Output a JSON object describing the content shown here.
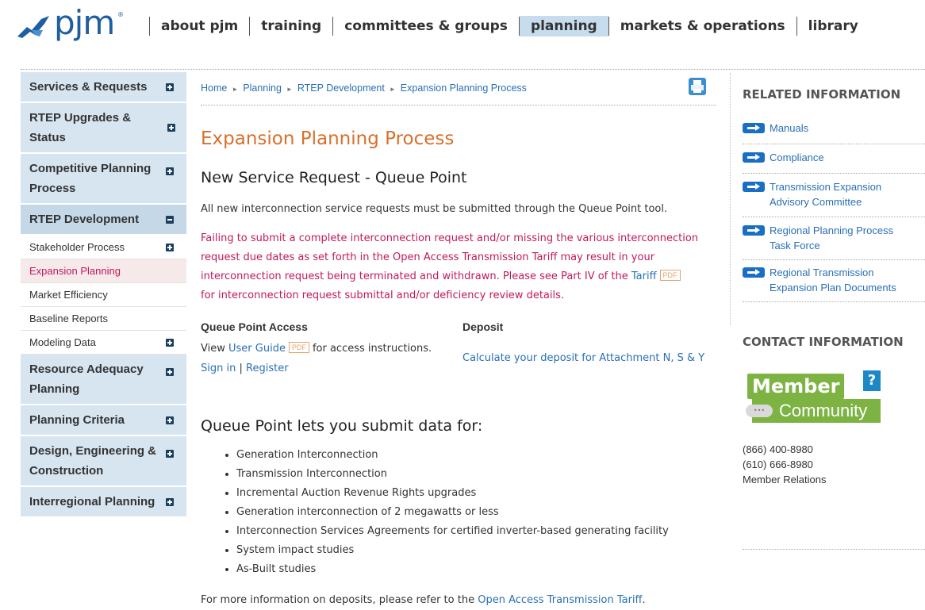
{
  "header": {
    "logo_text": "pjm",
    "logo_mark": "®",
    "nav": [
      {
        "label": "about pjm"
      },
      {
        "label": "training"
      },
      {
        "label": "committees & groups"
      },
      {
        "label": "planning",
        "active": true
      },
      {
        "label": "markets & operations"
      },
      {
        "label": "library"
      }
    ]
  },
  "sidebar": {
    "items": [
      {
        "label": "Services & Requests"
      },
      {
        "label": "RTEP Upgrades & Status"
      },
      {
        "label": "Competitive Planning Process"
      },
      {
        "label": "RTEP Development"
      },
      {
        "label": "Resource Adequacy Planning"
      },
      {
        "label": "Planning Criteria"
      },
      {
        "label": "Design, Engineering & Construction"
      },
      {
        "label": "Interregional Planning"
      }
    ],
    "subitems": [
      {
        "label": "Stakeholder Process"
      },
      {
        "label": "Expansion Planning Process"
      },
      {
        "label": "Market Efficiency"
      },
      {
        "label": "Baseline Reports"
      },
      {
        "label": "Modeling Data"
      }
    ]
  },
  "breadcrumb": [
    "Home",
    "Planning",
    "RTEP Development",
    "Expansion Planning Process"
  ],
  "main": {
    "title": "Expansion Planning Process",
    "subtitle": "New Service Request - Queue Point",
    "intro": "All new interconnection service requests must be submitted through the Queue Point tool.",
    "warning_line1": "Failing to submit a complete interconnection request and/or missing the various interconnection",
    "warning_line2": "request due dates as set forth in the Open Access Transmission Tariff may result in your",
    "warning_line3": "interconnection request being terminated and withdrawn. Please see Part IV of the",
    "warning_link": "Tariff",
    "pdf_label": "PDF",
    "warning_line4": "for interconnection request submittal and/or deficiency review details.",
    "access_heading": "Queue Point Access",
    "access_view": "View",
    "user_guide_link": "User Guide",
    "access_suffix": "for access instructions.",
    "sign_in": "Sign in",
    "separator": "|",
    "register": "Register",
    "deposit_heading": "Deposit",
    "deposit_link": "Calculate your deposit for Attachment N, S & Y",
    "submit_heading": "Queue Point lets you submit data for:",
    "submit_items": [
      "Generation Interconnection",
      "Transmission Interconnection",
      "Incremental Auction Revenue Rights upgrades",
      "Generation interconnection of 2 megawatts or less",
      "Interconnection Services Agreements for certified inverter-based generating facility",
      "System impact studies",
      "As-Built studies"
    ],
    "footer_text": "For more information on deposits, please refer to the",
    "footer_link": "Open Access Transmission Tariff",
    "footer_end": "."
  },
  "related": {
    "heading": "RELATED INFORMATION",
    "links": [
      "Manuals",
      "Compliance",
      "Transmission Expansion Advisory Committee",
      "Regional Planning Process Task Force",
      "Regional Transmission Expansion Plan Documents"
    ]
  },
  "contact": {
    "heading": "CONTACT INFORMATION",
    "badge_member": "Member",
    "badge_question": "?",
    "badge_community": "Community",
    "badge_dots": "•••",
    "phone1": "(866) 400-8980",
    "phone2": "(610) 666-8980",
    "member_relations": "Member Relations"
  },
  "colors": {
    "brand_blue": "#1f5f9f",
    "title_orange": "#d8702a",
    "warning_magenta": "#c2185b",
    "link_blue": "#2a6fb5",
    "sidebar_bg": "#d7e5f0",
    "badge_green": "#7cb342"
  }
}
